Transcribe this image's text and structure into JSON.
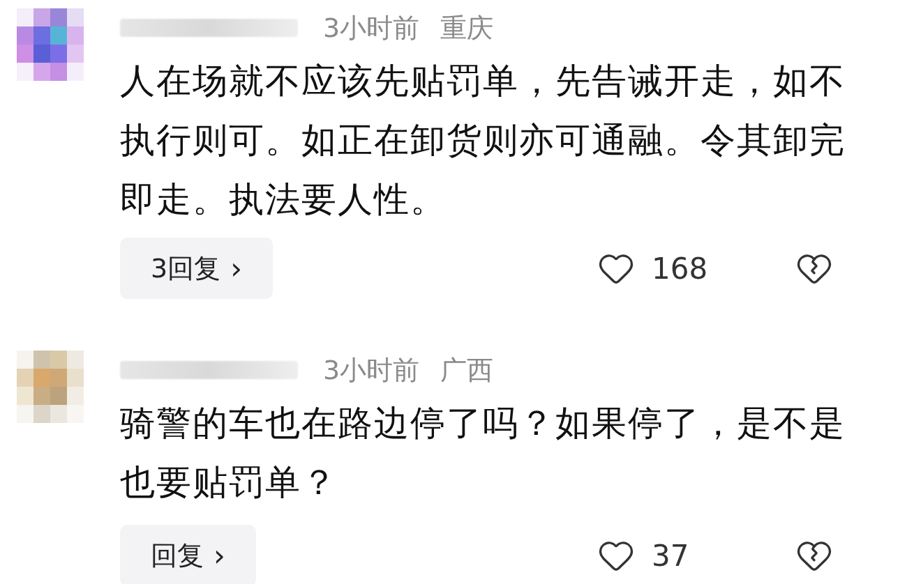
{
  "comments": [
    {
      "time": "3小时前",
      "location": "重庆",
      "lines": [
        "人在场就不应该先贴罚单，先告诫开走，如不",
        "执行则可。如正在卸货则亦可通融。令其卸完",
        "即走。执法要人性。"
      ],
      "reply_label": "3回复",
      "reply_arrow": "›",
      "likes": "168"
    },
    {
      "time": "3小时前",
      "location": "广西",
      "lines": [
        "骑警的车也在路边停了吗？如果停了，是不是",
        "也要贴罚单？"
      ],
      "reply_label": "回复",
      "reply_arrow": "›",
      "likes": "37"
    }
  ]
}
